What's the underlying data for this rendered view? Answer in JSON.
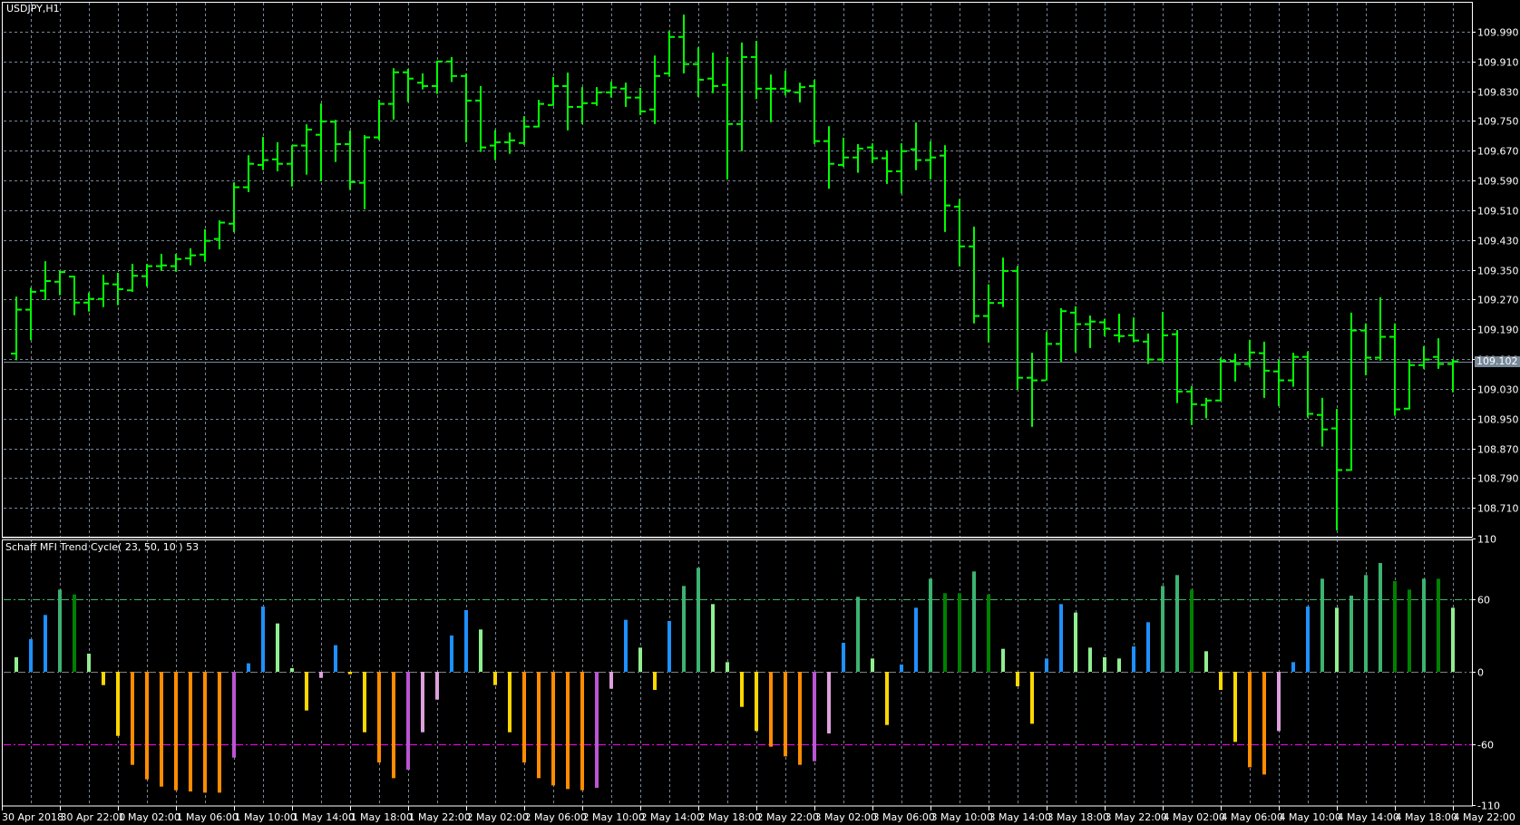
{
  "window": {
    "symbol_title": "USDJPY,H1"
  },
  "colors": {
    "background": "#000000",
    "bar": "#00FF00",
    "grid": "#778899",
    "frame": "#FFFFFF",
    "level_high": "#3CB371",
    "level_low": "#FF00FF",
    "level_zero": "#808080",
    "current_price_line": "#778899"
  },
  "price_axis": {
    "labels": [
      "109.990",
      "109.910",
      "109.830",
      "109.750",
      "109.670",
      "109.590",
      "109.510",
      "109.430",
      "109.350",
      "109.270",
      "109.190",
      "109.110",
      "109.030",
      "108.950",
      "108.870",
      "108.790",
      "108.710"
    ],
    "current_price": "109.102"
  },
  "time_axis": {
    "first_label": "30 Apr 2018",
    "labels": [
      "30 Apr 22:00",
      "1 May 02:00",
      "1 May 06:00",
      "1 May 10:00",
      "1 May 14:00",
      "1 May 18:00",
      "1 May 22:00",
      "2 May 02:00",
      "2 May 06:00",
      "2 May 10:00",
      "2 May 14:00",
      "2 May 18:00",
      "2 May 22:00",
      "3 May 02:00",
      "3 May 06:00",
      "3 May 10:00",
      "3 May 14:00",
      "3 May 18:00",
      "3 May 22:00",
      "4 May 02:00",
      "4 May 06:00",
      "4 May 10:00",
      "4 May 14:00",
      "4 May 18:00",
      "4 May 22:00"
    ]
  },
  "chart_data": [
    {
      "type": "ohlc",
      "title": "USDJPY,H1",
      "ylim": [
        108.64,
        110.06
      ],
      "bars_ohlc": [
        [
          109.125,
          109.278,
          109.107,
          109.243
        ],
        [
          109.243,
          109.302,
          109.161,
          109.291
        ],
        [
          109.294,
          109.373,
          109.269,
          109.32
        ],
        [
          109.318,
          109.348,
          109.282,
          109.344
        ],
        [
          109.332,
          109.334,
          109.228,
          109.262
        ],
        [
          109.262,
          109.289,
          109.238,
          109.272
        ],
        [
          109.272,
          109.337,
          109.25,
          109.313
        ],
        [
          109.311,
          109.342,
          109.255,
          109.298
        ],
        [
          109.295,
          109.366,
          109.291,
          109.334
        ],
        [
          109.333,
          109.366,
          109.305,
          109.36
        ],
        [
          109.36,
          109.393,
          109.347,
          109.362
        ],
        [
          109.36,
          109.393,
          109.345,
          109.379
        ],
        [
          109.381,
          109.408,
          109.362,
          109.389
        ],
        [
          109.391,
          109.459,
          109.372,
          109.428
        ],
        [
          109.433,
          109.483,
          109.405,
          109.477
        ],
        [
          109.474,
          109.585,
          109.451,
          109.572
        ],
        [
          109.572,
          109.658,
          109.559,
          109.635
        ],
        [
          109.632,
          109.707,
          109.618,
          109.645
        ],
        [
          109.647,
          109.693,
          109.615,
          109.635
        ],
        [
          109.635,
          109.685,
          109.574,
          109.684
        ],
        [
          109.684,
          109.741,
          109.606,
          109.727
        ],
        [
          109.713,
          109.797,
          109.589,
          109.749
        ],
        [
          109.748,
          109.753,
          109.64,
          109.688
        ],
        [
          109.688,
          109.724,
          109.565,
          109.586
        ],
        [
          109.584,
          109.712,
          109.513,
          109.706
        ],
        [
          109.706,
          109.807,
          109.699,
          109.796
        ],
        [
          109.796,
          109.892,
          109.754,
          109.881
        ],
        [
          109.881,
          109.89,
          109.801,
          109.864
        ],
        [
          109.853,
          109.878,
          109.835,
          109.844
        ],
        [
          109.844,
          109.912,
          109.823,
          109.91
        ],
        [
          109.91,
          109.922,
          109.855,
          109.871
        ],
        [
          109.871,
          109.878,
          109.693,
          109.805
        ],
        [
          109.805,
          109.844,
          109.667,
          109.679
        ],
        [
          109.684,
          109.726,
          109.645,
          109.693
        ],
        [
          109.693,
          109.719,
          109.662,
          109.698
        ],
        [
          109.691,
          109.763,
          109.685,
          109.735
        ],
        [
          109.735,
          109.807,
          109.733,
          109.796
        ],
        [
          109.793,
          109.868,
          109.791,
          109.844
        ],
        [
          109.844,
          109.88,
          109.725,
          109.788
        ],
        [
          109.788,
          109.841,
          109.742,
          109.798
        ],
        [
          109.798,
          109.841,
          109.791,
          109.827
        ],
        [
          109.827,
          109.856,
          109.813,
          109.84
        ],
        [
          109.837,
          109.853,
          109.788,
          109.813
        ],
        [
          109.813,
          109.839,
          109.766,
          109.776
        ],
        [
          109.781,
          109.926,
          109.742,
          109.871
        ],
        [
          109.878,
          109.993,
          109.869,
          109.976
        ],
        [
          109.976,
          110.036,
          109.878,
          109.903
        ],
        [
          109.903,
          109.948,
          109.815,
          109.861
        ],
        [
          109.864,
          109.934,
          109.825,
          109.844
        ],
        [
          109.847,
          109.922,
          109.593,
          109.742
        ],
        [
          109.742,
          109.961,
          109.669,
          109.922
        ],
        [
          109.922,
          109.965,
          109.809,
          109.837
        ],
        [
          109.837,
          109.875,
          109.747,
          109.837
        ],
        [
          109.837,
          109.885,
          109.819,
          109.832
        ],
        [
          109.827,
          109.853,
          109.8,
          109.841
        ],
        [
          109.844,
          109.861,
          109.688,
          109.696
        ],
        [
          109.696,
          109.736,
          109.568,
          109.635
        ],
        [
          109.632,
          109.705,
          109.627,
          109.652
        ],
        [
          109.652,
          109.688,
          109.611,
          109.676
        ],
        [
          109.679,
          109.69,
          109.637,
          109.65
        ],
        [
          109.65,
          109.671,
          109.581,
          109.615
        ],
        [
          109.615,
          109.69,
          109.555,
          109.669
        ],
        [
          109.674,
          109.746,
          109.618,
          109.645
        ],
        [
          109.645,
          109.695,
          109.593,
          109.652
        ],
        [
          109.657,
          109.685,
          109.452,
          109.523
        ],
        [
          109.52,
          109.54,
          109.36,
          109.413
        ],
        [
          109.413,
          109.466,
          109.206,
          109.226
        ],
        [
          109.226,
          109.311,
          109.155,
          109.261
        ],
        [
          109.261,
          109.383,
          109.25,
          109.347
        ],
        [
          109.347,
          109.36,
          109.028,
          109.06
        ],
        [
          109.06,
          109.127,
          108.928,
          109.053
        ],
        [
          109.053,
          109.183,
          109.053,
          109.151
        ],
        [
          109.151,
          109.247,
          109.103,
          109.239
        ],
        [
          109.235,
          109.252,
          109.128,
          109.204
        ],
        [
          109.204,
          109.227,
          109.14,
          109.211
        ],
        [
          109.209,
          109.218,
          109.172,
          109.192
        ],
        [
          109.174,
          109.232,
          109.155,
          109.172
        ],
        [
          109.174,
          109.222,
          109.156,
          109.16
        ],
        [
          109.157,
          109.179,
          109.097,
          109.109
        ],
        [
          109.109,
          109.237,
          109.101,
          109.174
        ],
        [
          109.177,
          109.188,
          108.992,
          109.023
        ],
        [
          109.023,
          109.037,
          108.933,
          108.989
        ],
        [
          108.987,
          109.006,
          108.951,
          108.999
        ],
        [
          108.999,
          109.114,
          108.997,
          109.105
        ],
        [
          109.105,
          109.125,
          109.05,
          109.097
        ],
        [
          109.097,
          109.162,
          109.088,
          109.128
        ],
        [
          109.126,
          109.157,
          109.006,
          109.079
        ],
        [
          109.077,
          109.108,
          108.984,
          109.053
        ],
        [
          109.053,
          109.127,
          109.036,
          109.116
        ],
        [
          109.116,
          109.131,
          108.953,
          108.963
        ],
        [
          108.96,
          109.006,
          108.875,
          108.921
        ],
        [
          108.924,
          108.976,
          108.65,
          108.812
        ],
        [
          108.812,
          109.235,
          108.81,
          109.187
        ],
        [
          109.187,
          109.206,
          109.067,
          109.114
        ],
        [
          109.114,
          109.276,
          109.106,
          109.17
        ],
        [
          109.17,
          109.206,
          108.958,
          108.975
        ],
        [
          108.977,
          109.108,
          108.975,
          109.094
        ],
        [
          109.094,
          109.145,
          109.084,
          109.109
        ],
        [
          109.116,
          109.166,
          109.084,
          109.097
        ],
        [
          109.097,
          109.11,
          109.021,
          109.104
        ]
      ]
    },
    {
      "type": "bar",
      "title": "Schaff MFI Trend Cycle( 23, 50, 10 ) 53",
      "ylim": [
        -110,
        110
      ],
      "axis_labels": [
        "110",
        "60",
        "0",
        "-60",
        "-110"
      ],
      "levels": [
        60,
        0,
        -60
      ],
      "palette": {
        "lg": "#90EE90",
        "bl": "#1E90FF",
        "sg": "#3CB371",
        "dg": "#008000",
        "go": "#FFD700",
        "or": "#FF8C00",
        "mo": "#BA55D3",
        "pl": "#DDA0DD"
      },
      "values": [
        12,
        27,
        47,
        68,
        64,
        15,
        -11,
        -53,
        -77,
        -89,
        -95,
        -98,
        -99,
        -100,
        -100,
        -71,
        7,
        54,
        40,
        3,
        -32,
        -5,
        22,
        -2,
        -50,
        -75,
        -88,
        -81,
        -50,
        -23,
        30,
        51,
        35,
        -11,
        -50,
        -75,
        -88,
        -94,
        -97,
        -98,
        -96,
        -14,
        43,
        20,
        -15,
        42,
        71,
        86,
        56,
        8,
        -29,
        -49,
        -62,
        -70,
        -77,
        -74,
        -51,
        24,
        62,
        11,
        -44,
        6,
        53,
        77,
        65,
        65,
        83,
        64,
        19,
        -12,
        -43,
        11,
        56,
        49,
        20,
        12,
        11,
        21,
        41,
        71,
        80,
        68,
        17,
        -15,
        -58,
        -79,
        -85,
        -49,
        8,
        54,
        77,
        53,
        63,
        80,
        90,
        75,
        68,
        77,
        77,
        53
      ],
      "colors": [
        "lg",
        "bl",
        "bl",
        "sg",
        "dg",
        "lg",
        "go",
        "go",
        "or",
        "or",
        "or",
        "or",
        "or",
        "or",
        "or",
        "mo",
        "bl",
        "bl",
        "lg",
        "lg",
        "go",
        "pl",
        "bl",
        "go",
        "go",
        "or",
        "or",
        "mo",
        "pl",
        "pl",
        "bl",
        "bl",
        "lg",
        "go",
        "go",
        "or",
        "or",
        "or",
        "or",
        "or",
        "mo",
        "pl",
        "bl",
        "lg",
        "go",
        "bl",
        "sg",
        "sg",
        "lg",
        "lg",
        "go",
        "go",
        "or",
        "or",
        "or",
        "mo",
        "pl",
        "bl",
        "sg",
        "lg",
        "go",
        "bl",
        "bl",
        "sg",
        "dg",
        "dg",
        "sg",
        "dg",
        "lg",
        "go",
        "go",
        "bl",
        "bl",
        "lg",
        "lg",
        "lg",
        "lg",
        "bl",
        "bl",
        "sg",
        "sg",
        "dg",
        "lg",
        "go",
        "go",
        "or",
        "or",
        "pl",
        "bl",
        "bl",
        "sg",
        "lg",
        "sg",
        "sg",
        "sg",
        "dg",
        "dg",
        "sg",
        "dg",
        "lg"
      ]
    }
  ]
}
